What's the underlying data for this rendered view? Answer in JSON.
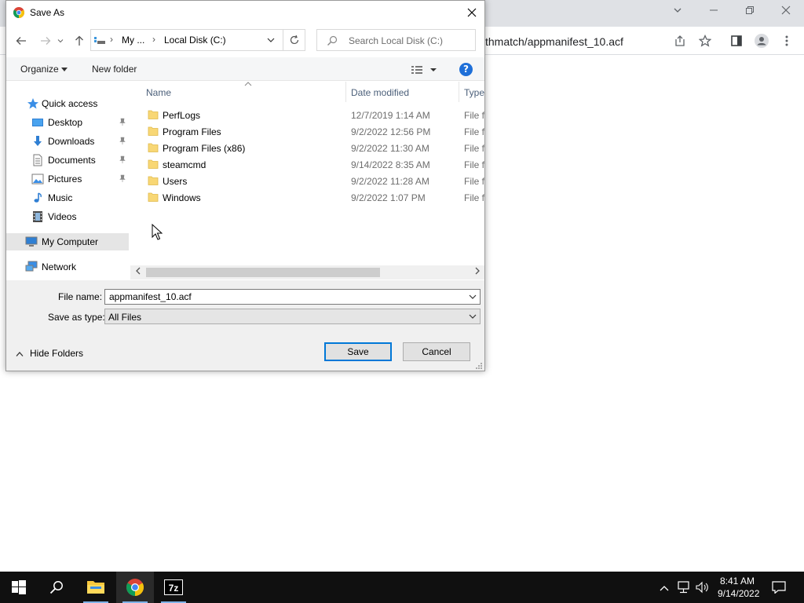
{
  "chrome": {
    "url_fragment": "thmatch/appmanifest_10.acf",
    "window_controls": [
      "chevron-down-icon",
      "minimize-icon",
      "restore-icon",
      "close-icon"
    ],
    "toolbar_icons": [
      "share-icon",
      "star-icon",
      "side-panel-icon",
      "profile-icon",
      "menu-icon"
    ]
  },
  "dialog": {
    "title": "Save As",
    "address": {
      "segments": [
        "My ...",
        "Local Disk (C:)"
      ]
    },
    "search_placeholder": "Search Local Disk (C:)",
    "commands": {
      "organize": "Organize",
      "new_folder": "New folder"
    },
    "nav_pane": {
      "quick_access": "Quick access",
      "items": [
        {
          "label": "Desktop",
          "icon": "desktop-icon",
          "pinned": true
        },
        {
          "label": "Downloads",
          "icon": "downloads-icon",
          "pinned": true
        },
        {
          "label": "Documents",
          "icon": "documents-icon",
          "pinned": true
        },
        {
          "label": "Pictures",
          "icon": "pictures-icon",
          "pinned": true
        },
        {
          "label": "Music",
          "icon": "music-icon",
          "pinned": false
        },
        {
          "label": "Videos",
          "icon": "videos-icon",
          "pinned": false
        }
      ],
      "my_computer": "My Computer",
      "network": "Network"
    },
    "columns": {
      "name": "Name",
      "date": "Date modified",
      "type": "Type"
    },
    "files": [
      {
        "name": "PerfLogs",
        "date": "12/7/2019 1:14 AM",
        "type": "File fo"
      },
      {
        "name": "Program Files",
        "date": "9/2/2022 12:56 PM",
        "type": "File fo"
      },
      {
        "name": "Program Files (x86)",
        "date": "9/2/2022 11:30 AM",
        "type": "File fo"
      },
      {
        "name": "steamcmd",
        "date": "9/14/2022 8:35 AM",
        "type": "File fo"
      },
      {
        "name": "Users",
        "date": "9/2/2022 11:28 AM",
        "type": "File fo"
      },
      {
        "name": "Windows",
        "date": "9/2/2022 1:07 PM",
        "type": "File fo"
      }
    ],
    "form": {
      "file_name_label": "File name:",
      "file_name_value": "appmanifest_10.acf",
      "save_type_label": "Save as type:",
      "save_type_value": "All Files"
    },
    "hide_folders": "Hide Folders",
    "save_button": "Save",
    "cancel_button": "Cancel",
    "accent_color": "#0078d7",
    "folder_color": "#f8d775"
  },
  "taskbar": {
    "apps": [
      "start-icon",
      "search-icon",
      "file-explorer-icon",
      "chrome-icon",
      "7zip-icon"
    ],
    "time": "8:41 AM",
    "date": "9/14/2022"
  }
}
